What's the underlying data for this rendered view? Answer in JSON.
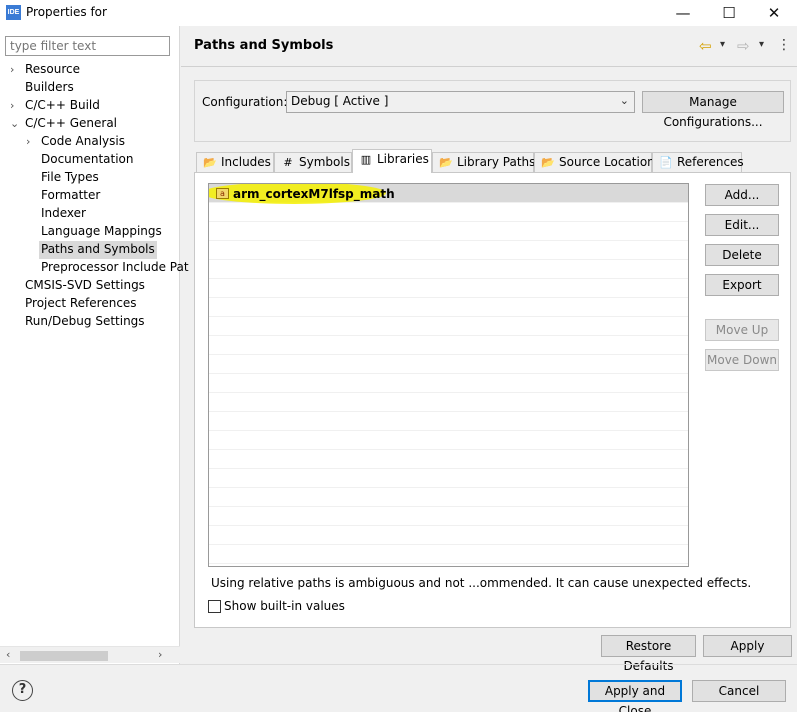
{
  "window": {
    "app_icon_text": "IDE",
    "title": "Properties for",
    "minimize_glyph": "—",
    "maximize_glyph": "☐",
    "close_glyph": "✕"
  },
  "left": {
    "filter_placeholder": "type filter text",
    "tree": [
      {
        "label": "Resource",
        "chevron": "›"
      },
      {
        "label": "Builders",
        "chevron": ""
      },
      {
        "label": "C/C++ Build",
        "chevron": "›"
      },
      {
        "label": "C/C++ General",
        "chevron": "⌄"
      },
      {
        "label": "Code Analysis",
        "chevron": "›"
      },
      {
        "label": "Documentation",
        "chevron": ""
      },
      {
        "label": "File Types",
        "chevron": ""
      },
      {
        "label": "Formatter",
        "chevron": ""
      },
      {
        "label": "Indexer",
        "chevron": ""
      },
      {
        "label": "Language Mappings",
        "chevron": ""
      },
      {
        "label": "Paths and Symbols",
        "chevron": "",
        "selected": true
      },
      {
        "label": "Preprocessor Include Pat",
        "chevron": ""
      },
      {
        "label": "CMSIS-SVD Settings",
        "chevron": ""
      },
      {
        "label": "Project References",
        "chevron": ""
      },
      {
        "label": "Run/Debug Settings",
        "chevron": ""
      }
    ],
    "scroll_left": "‹",
    "scroll_right": "›"
  },
  "page": {
    "title": "Paths and Symbols",
    "nav_back_icon": "⇦",
    "nav_back_menu": "▾",
    "nav_forward_icon": "⇨",
    "nav_forward_menu": "▾",
    "more_icon": "⋮"
  },
  "config": {
    "label": "Configuration:",
    "value": "Debug  [ Active ]",
    "arrow": "⌄",
    "manage_button": "Manage Configurations..."
  },
  "tabs": [
    {
      "label": "Includes",
      "icon": "📂"
    },
    {
      "label": "Symbols",
      "icon": "#"
    },
    {
      "label": "Libraries",
      "icon": "▥",
      "active": true
    },
    {
      "label": "Library Paths",
      "icon": "📂"
    },
    {
      "label": "Source Location",
      "icon": "📂"
    },
    {
      "label": "References",
      "icon": "📄"
    }
  ],
  "libraries": {
    "items": [
      "arm_cortexM7lfsp_math"
    ],
    "highlight_color": "#f5f000"
  },
  "side_buttons": {
    "add": "Add...",
    "edit": "Edit...",
    "delete": "Delete",
    "export": "Export",
    "move_up": "Move Up",
    "move_down": "Move Down"
  },
  "warning_text": "Using relative paths is ambiguous and not ...ommended. It can cause unexpected effects.",
  "show_builtin": {
    "label": "Show built-in values",
    "checked": false
  },
  "footer": {
    "restore_defaults": "Restore Defaults",
    "apply": "Apply",
    "apply_and_close": "Apply and Close",
    "cancel": "Cancel",
    "help_glyph": "?"
  }
}
